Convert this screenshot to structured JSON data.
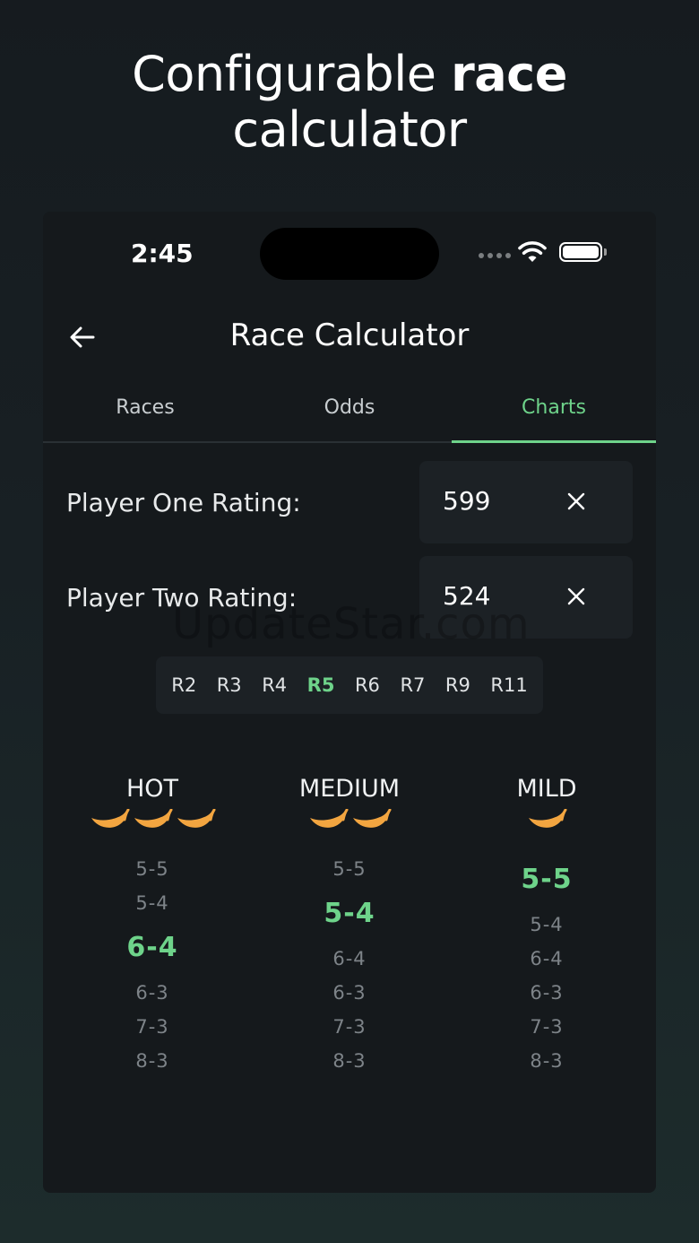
{
  "headline": {
    "part1": "Configurable",
    "part2": "race",
    "part3": "calculator"
  },
  "status": {
    "time": "2:45"
  },
  "appbar": {
    "title": "Race Calculator",
    "back_icon": "arrow-left-icon"
  },
  "tabs": [
    {
      "label": "Races"
    },
    {
      "label": "Odds"
    },
    {
      "label": "Charts",
      "active": true
    }
  ],
  "fields": {
    "player_one": {
      "label": "Player One Rating:",
      "value": "599"
    },
    "player_two": {
      "label": "Player Two Rating:",
      "value": "524"
    }
  },
  "watermark": "UpdateStar.com",
  "race_selector": {
    "options": [
      "R2",
      "R3",
      "R4",
      "R5",
      "R6",
      "R7",
      "R9",
      "R11"
    ],
    "selected": "R5"
  },
  "colors": {
    "accent": "#6ed38a",
    "pepper": "#f2a540",
    "muted": "#7d8388"
  },
  "columns": [
    {
      "heading": "HOT",
      "peppers": 3,
      "items": [
        "5-5",
        "5-4",
        "6-4",
        "6-3",
        "7-3",
        "8-3"
      ],
      "active_index": 2
    },
    {
      "heading": "MEDIUM",
      "peppers": 2,
      "items": [
        "5-5",
        "5-4",
        "6-4",
        "6-3",
        "7-3",
        "8-3"
      ],
      "active_index": 1
    },
    {
      "heading": "MILD",
      "peppers": 1,
      "items": [
        "5-5",
        "5-4",
        "6-4",
        "6-3",
        "7-3",
        "8-3"
      ],
      "active_index": 0
    }
  ]
}
